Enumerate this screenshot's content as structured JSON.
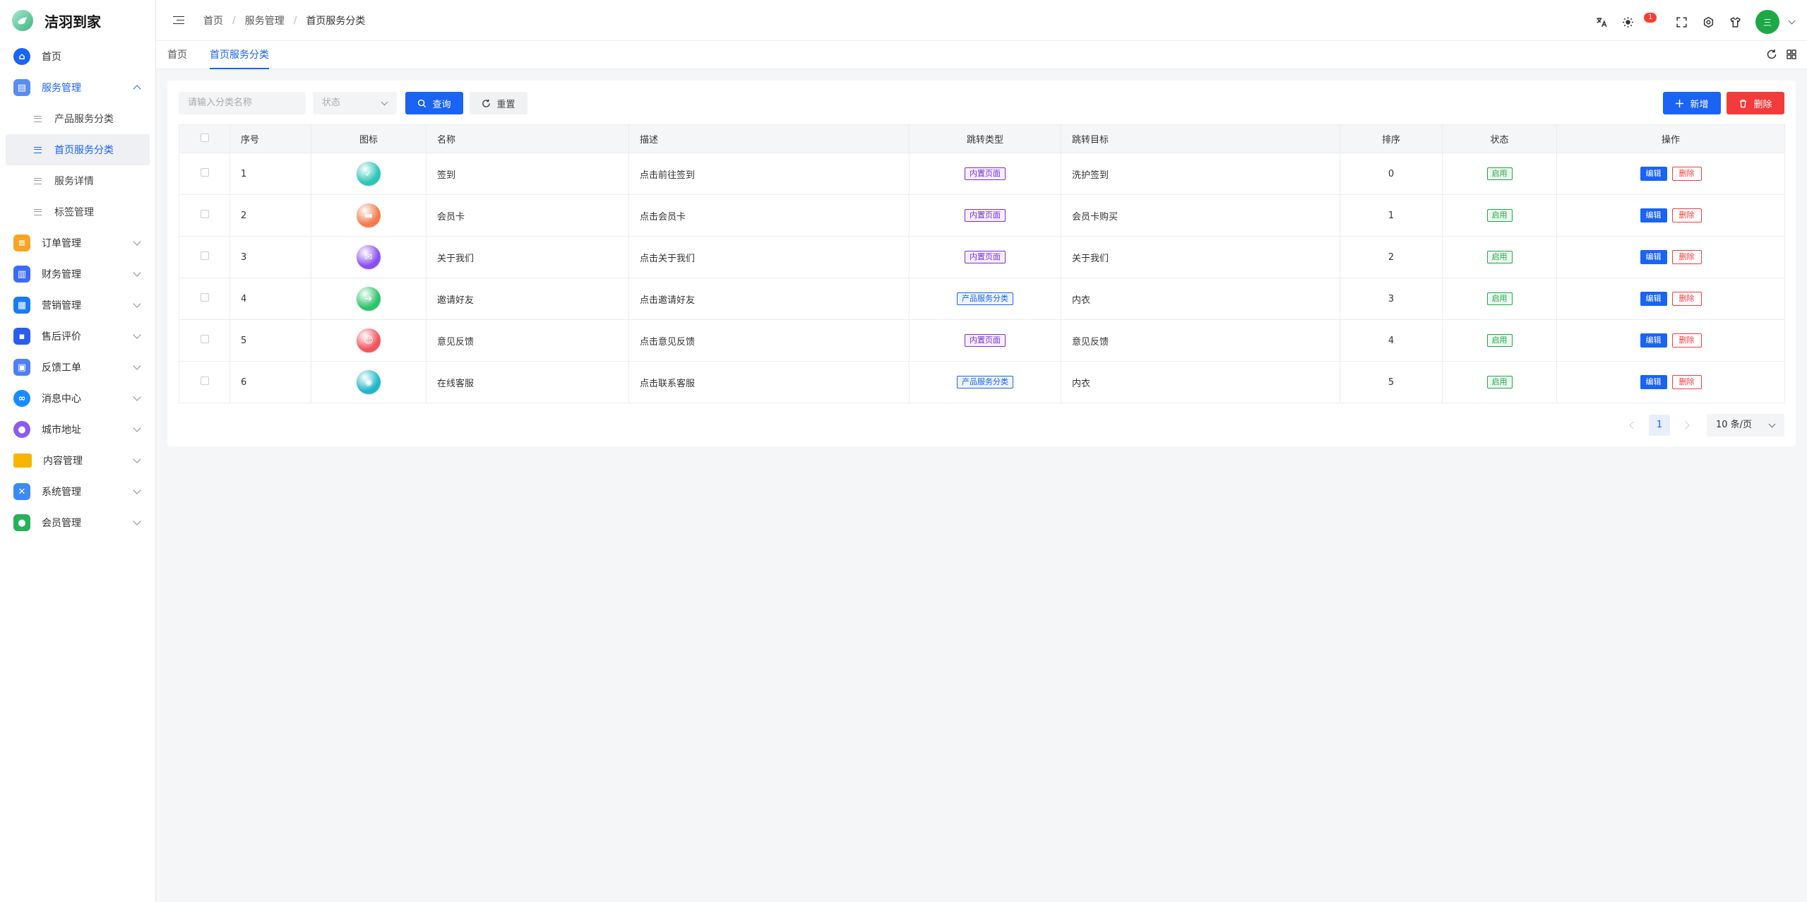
{
  "app": {
    "name": "洁羽到家"
  },
  "sidebar": {
    "items": [
      {
        "label": "首页",
        "icon": "home-icon",
        "color": "#1a63f4"
      },
      {
        "label": "服务管理",
        "icon": "clipboard-icon",
        "color": "#5b8def",
        "open": true,
        "children": [
          {
            "label": "产品服务分类"
          },
          {
            "label": "首页服务分类",
            "active": true
          },
          {
            "label": "服务详情"
          },
          {
            "label": "标签管理"
          }
        ]
      },
      {
        "label": "订单管理",
        "icon": "order-icon",
        "color": "#f5a623"
      },
      {
        "label": "财务管理",
        "icon": "finance-icon",
        "color": "#3b6cf5"
      },
      {
        "label": "营销管理",
        "icon": "marketing-icon",
        "color": "#1a7bf4"
      },
      {
        "label": "售后评价",
        "icon": "apps-icon",
        "color": "#2b5ef0"
      },
      {
        "label": "反馈工单",
        "icon": "feedback-icon",
        "color": "#4f7ff5"
      },
      {
        "label": "消息中心",
        "icon": "link-icon",
        "color": "#1a8cff"
      },
      {
        "label": "城市地址",
        "icon": "planet-icon",
        "color": "#8a5cf0"
      },
      {
        "label": "内容管理",
        "icon": "folder-icon",
        "color": "#f7b500"
      },
      {
        "label": "系统管理",
        "icon": "tools-icon",
        "color": "#3d8af7"
      },
      {
        "label": "会员管理",
        "icon": "user-icon",
        "color": "#27b15a"
      }
    ]
  },
  "header": {
    "breadcrumb": [
      "首页",
      "服务管理",
      "首页服务分类"
    ],
    "notification_count": "1",
    "avatar_text": "三"
  },
  "tabs": [
    {
      "label": "首页"
    },
    {
      "label": "首页服务分类",
      "active": true
    }
  ],
  "filters": {
    "name_placeholder": "请输入分类名称",
    "status_placeholder": "状态",
    "query_label": "查询",
    "reset_label": "重置",
    "add_label": "新增",
    "delete_label": "删除"
  },
  "table": {
    "columns": [
      "序号",
      "图标",
      "名称",
      "描述",
      "跳转类型",
      "跳转目标",
      "排序",
      "状态",
      "操作"
    ],
    "rows": [
      {
        "index": "1",
        "icon_color": "#2cc5b8",
        "name": "签到",
        "desc": "点击前往签到",
        "jump_type": "内置页面",
        "jump_type_style": "purple",
        "target": "洗护签到",
        "sort": "0",
        "status": "启用"
      },
      {
        "index": "2",
        "icon_color": "#f57b4d",
        "name": "会员卡",
        "desc": "点击会员卡",
        "jump_type": "内置页面",
        "jump_type_style": "purple",
        "target": "会员卡购买",
        "sort": "1",
        "status": "启用"
      },
      {
        "index": "3",
        "icon_color": "#8a4ff0",
        "name": "关于我们",
        "desc": "点击关于我们",
        "jump_type": "内置页面",
        "jump_type_style": "purple",
        "target": "关于我们",
        "sort": "2",
        "status": "启用"
      },
      {
        "index": "4",
        "icon_color": "#2bc46a",
        "name": "邀请好友",
        "desc": "点击邀请好友",
        "jump_type": "产品服务分类",
        "jump_type_style": "blue",
        "target": "内衣",
        "sort": "3",
        "status": "启用"
      },
      {
        "index": "5",
        "icon_color": "#f2545b",
        "name": "意见反馈",
        "desc": "点击意见反馈",
        "jump_type": "内置页面",
        "jump_type_style": "purple",
        "target": "意见反馈",
        "sort": "4",
        "status": "启用"
      },
      {
        "index": "6",
        "icon_color": "#1fb8c9",
        "name": "在线客服",
        "desc": "点击联系客服",
        "jump_type": "产品服务分类",
        "jump_type_style": "blue",
        "target": "内衣",
        "sort": "5",
        "status": "启用"
      }
    ],
    "edit_label": "编辑",
    "delete_label": "删除"
  },
  "pagination": {
    "current_page": "1",
    "page_size": "10 条/页"
  }
}
